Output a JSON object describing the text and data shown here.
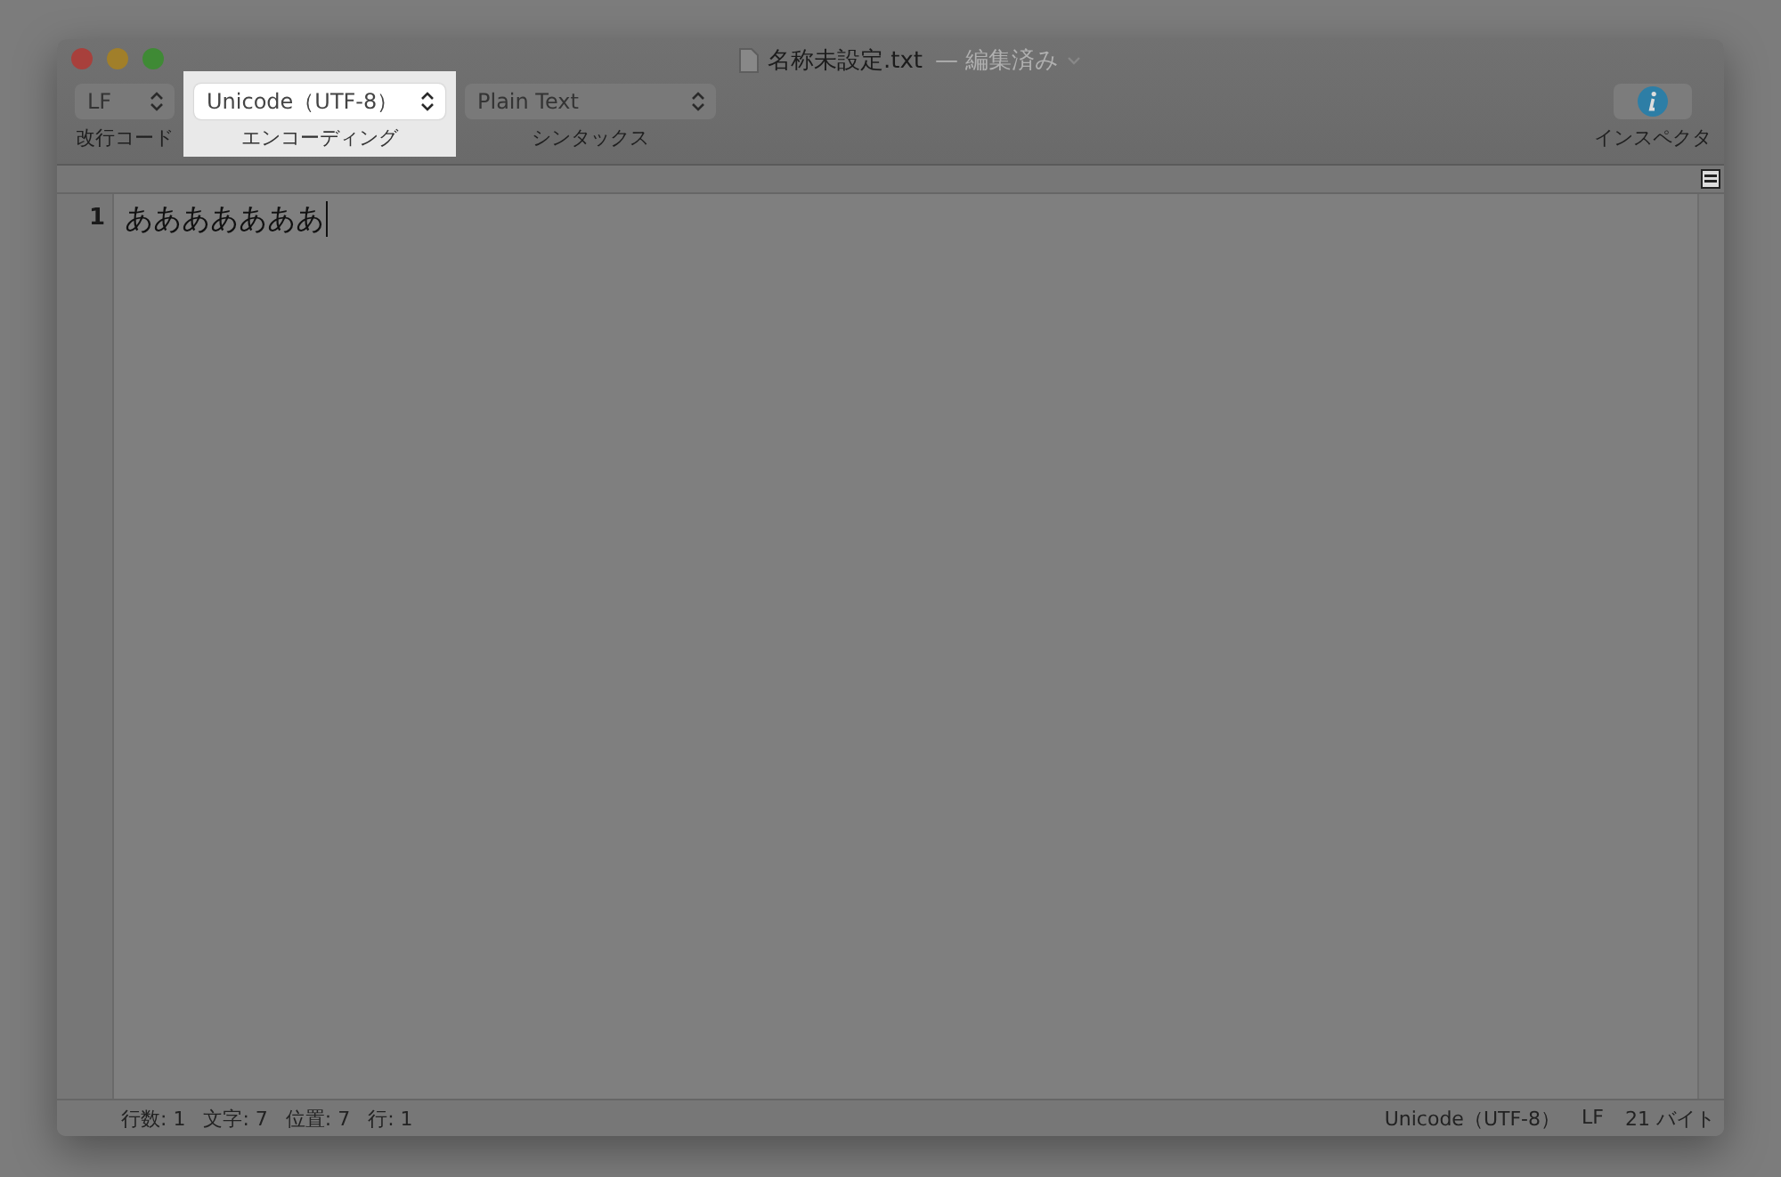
{
  "window": {
    "title": "名称未設定.txt",
    "title_status": "— 編集済み"
  },
  "toolbar": {
    "popups": [
      {
        "value": "LF",
        "label": "改行コード",
        "highlighted": false
      },
      {
        "value": "Unicode（UTF-8）",
        "label": "エンコーディング",
        "highlighted": true
      },
      {
        "value": "Plain Text",
        "label": "シンタックス",
        "highlighted": false
      }
    ],
    "inspector": {
      "label": "インスペクタ"
    }
  },
  "editor": {
    "lines": [
      {
        "number": "1",
        "text": "あああああああ"
      }
    ]
  },
  "status_bar": {
    "left": [
      "行数: 1",
      "文字: 7",
      "位置: 7",
      "行: 1"
    ],
    "right": [
      "Unicode（UTF-8）",
      "LF",
      "21 バイト"
    ]
  }
}
